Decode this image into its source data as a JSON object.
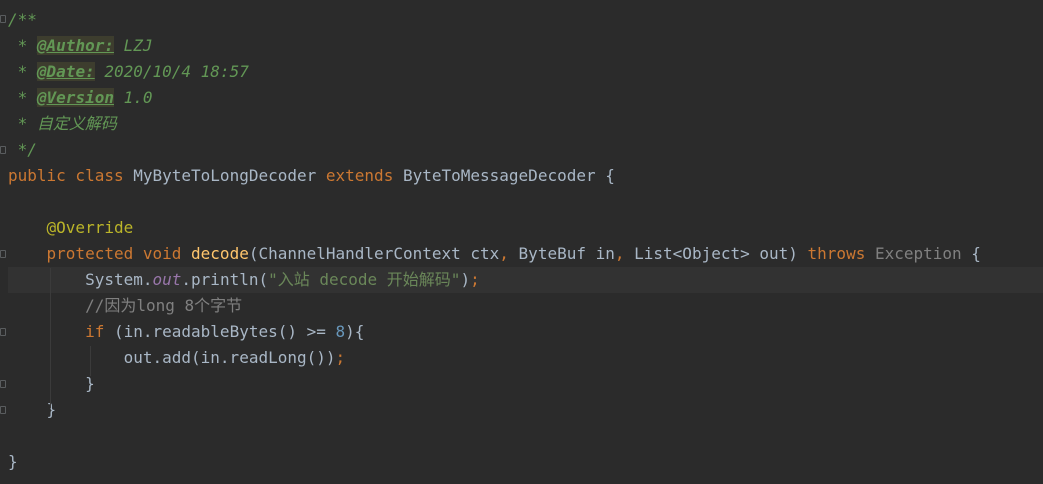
{
  "editor": {
    "lines": [
      {
        "segments": [
          {
            "cls": "cmt",
            "text": "/**"
          }
        ]
      },
      {
        "segments": [
          {
            "cls": "cmt",
            "text": " * "
          },
          {
            "cls": "tag",
            "text": "@Author:"
          },
          {
            "cls": "cmt",
            "text": " LZJ"
          }
        ]
      },
      {
        "segments": [
          {
            "cls": "cmt",
            "text": " * "
          },
          {
            "cls": "tag",
            "text": "@Date:"
          },
          {
            "cls": "cmt",
            "text": " 2020/10/4 18:57"
          }
        ]
      },
      {
        "segments": [
          {
            "cls": "cmt",
            "text": " * "
          },
          {
            "cls": "tag",
            "text": "@Version"
          },
          {
            "cls": "cmt",
            "text": " 1.0"
          }
        ]
      },
      {
        "segments": [
          {
            "cls": "cmt",
            "text": " * 自定义解码"
          }
        ]
      },
      {
        "segments": [
          {
            "cls": "cmt",
            "text": " */"
          }
        ]
      },
      {
        "segments": [
          {
            "cls": "kw",
            "text": "public class "
          },
          {
            "cls": "",
            "text": "MyByteToLongDecoder "
          },
          {
            "cls": "kw",
            "text": "extends "
          },
          {
            "cls": "",
            "text": "ByteToMessageDecoder {"
          }
        ]
      },
      {
        "segments": [
          {
            "cls": "",
            "text": ""
          }
        ]
      },
      {
        "segments": [
          {
            "cls": "ann",
            "text": "    @Override"
          }
        ]
      },
      {
        "segments": [
          {
            "cls": "kw",
            "text": "    protected void "
          },
          {
            "cls": "fn",
            "text": "decode"
          },
          {
            "cls": "",
            "text": "(ChannelHandlerContext ctx"
          },
          {
            "cls": "kw",
            "text": ", "
          },
          {
            "cls": "",
            "text": "ByteBuf in"
          },
          {
            "cls": "kw",
            "text": ", "
          },
          {
            "cls": "",
            "text": "List<Object> out) "
          },
          {
            "cls": "kw",
            "text": "throws "
          },
          {
            "cls": "gray",
            "text": "Exception"
          },
          {
            "cls": "",
            "text": " {"
          }
        ]
      },
      {
        "current": true,
        "segments": [
          {
            "cls": "",
            "text": "        System."
          },
          {
            "cls": "sfield",
            "text": "out"
          },
          {
            "cls": "",
            "text": ".println("
          },
          {
            "cls": "str",
            "text": "\"入站 decode 开始解码\""
          },
          {
            "cls": "",
            "text": ")"
          },
          {
            "cls": "kw",
            "text": ";"
          }
        ]
      },
      {
        "segments": [
          {
            "cls": "lc",
            "text": "        //因为long 8个字节"
          }
        ]
      },
      {
        "segments": [
          {
            "cls": "kw",
            "text": "        if "
          },
          {
            "cls": "",
            "text": "(in.readableBytes() >= "
          },
          {
            "cls": "num",
            "text": "8"
          },
          {
            "cls": "",
            "text": "){"
          }
        ]
      },
      {
        "segments": [
          {
            "cls": "",
            "text": "            out.add(in.readLong())"
          },
          {
            "cls": "kw",
            "text": ";"
          }
        ]
      },
      {
        "segments": [
          {
            "cls": "",
            "text": "        }"
          }
        ]
      },
      {
        "segments": [
          {
            "cls": "",
            "text": "    }"
          }
        ]
      },
      {
        "segments": [
          {
            "cls": "",
            "text": ""
          }
        ]
      },
      {
        "segments": [
          {
            "cls": "",
            "text": "}"
          }
        ]
      }
    ]
  }
}
